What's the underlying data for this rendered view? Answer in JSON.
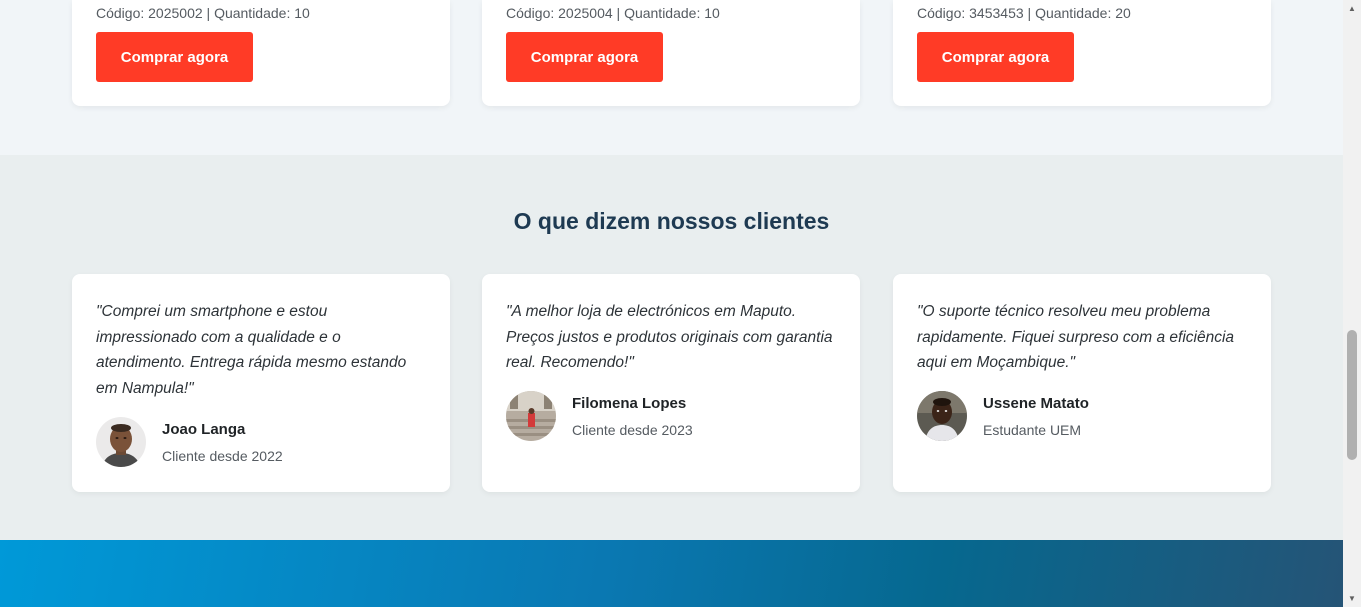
{
  "products": [
    {
      "meta": "Código: 2025002 | Quantidade: 10",
      "button_label": "Comprar agora"
    },
    {
      "meta": "Código: 2025004 | Quantidade: 10",
      "button_label": "Comprar agora"
    },
    {
      "meta": "Código: 3453453 | Quantidade: 20",
      "button_label": "Comprar agora"
    }
  ],
  "testimonials": {
    "title": "O que dizem nossos clientes",
    "items": [
      {
        "quote": "\"Comprei um smartphone e estou impressionado com a qualidade e o atendimento. Entrega rápida mesmo estando em Nampula!\"",
        "name": "Joao Langa",
        "subtitle": "Cliente desde 2022",
        "avatar_icon": "person-photo-avatar"
      },
      {
        "quote": "\"A melhor loja de electrónicos em Maputo. Preços justos e produtos originais com garantia real. Recomendo!\"",
        "name": "Filomena Lopes",
        "subtitle": "Cliente desde 2023",
        "avatar_icon": "person-photo-avatar"
      },
      {
        "quote": "\"O suporte técnico resolveu meu problema rapidamente. Fiquei surpreso com a eficiência aqui em Moçambique.\"",
        "name": "Ussene Matato",
        "subtitle": "Estudante UEM",
        "avatar_icon": "person-photo-avatar"
      }
    ]
  },
  "colors": {
    "accent_button": "#ff3b26",
    "title": "#1e3a52",
    "footer_start": "#0099d8",
    "footer_end": "#255476"
  }
}
